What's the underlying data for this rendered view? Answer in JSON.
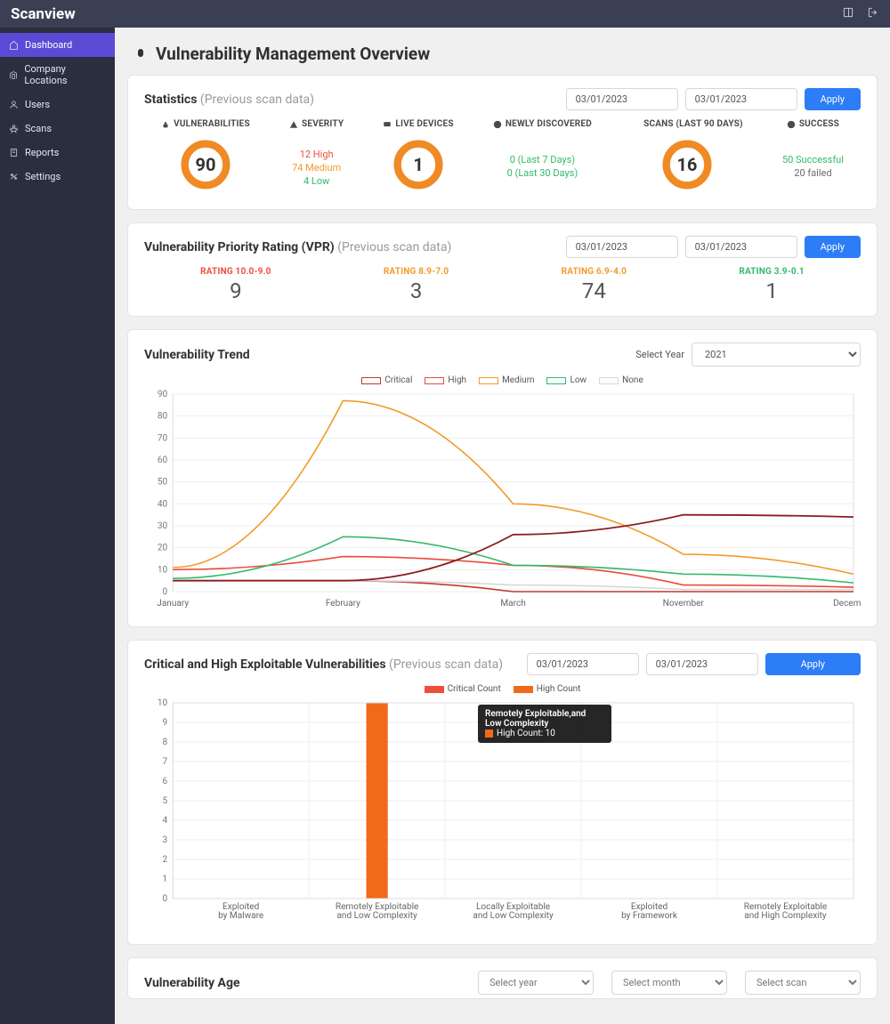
{
  "brand": "Scanview",
  "nav": [
    {
      "label": "Dashboard",
      "active": true
    },
    {
      "label": "Company Locations"
    },
    {
      "label": "Users"
    },
    {
      "label": "Scans"
    },
    {
      "label": "Reports"
    },
    {
      "label": "Settings"
    }
  ],
  "page_title": "Vulnerability Management Overview",
  "statistics": {
    "title": "Statistics",
    "subtitle": "(Previous scan data)",
    "date_from": "03/01/2023",
    "date_to": "03/01/2023",
    "apply": "Apply",
    "cols": {
      "vulns": {
        "label": "VULNERABILITIES",
        "value": "90"
      },
      "severity": {
        "label": "SEVERITY",
        "high": "12 High",
        "medium": "74 Medium",
        "low": "4 Low"
      },
      "live": {
        "label": "LIVE DEVICES",
        "value": "1"
      },
      "new": {
        "label": "NEWLY DISCOVERED",
        "l7": "0 (Last 7 Days)",
        "l30": "0 (Last 30 Days)"
      },
      "scans": {
        "label": "SCANS (LAST 90 DAYS)",
        "value": "16"
      },
      "success": {
        "label": "SUCCESS",
        "ok": "50 Successful",
        "fail": "20 failed"
      }
    }
  },
  "vpr": {
    "title": "Vulnerability Priority Rating (VPR)",
    "subtitle": "(Previous scan data)",
    "date_from": "03/01/2023",
    "date_to": "03/01/2023",
    "apply": "Apply",
    "buckets": [
      {
        "label": "RATING 10.0-9.0",
        "value": "9",
        "color": "#ef4e3b"
      },
      {
        "label": "RATING 8.9-7.0",
        "value": "3",
        "color": "#f39a2b"
      },
      {
        "label": "RATING 6.9-4.0",
        "value": "74",
        "color": "#f39a2b"
      },
      {
        "label": "RATING 3.9-0.1",
        "value": "1",
        "color": "#34b96d"
      }
    ]
  },
  "trend": {
    "title": "Vulnerability Trend",
    "select_label": "Select Year",
    "year": "2021",
    "legend": [
      "Critical",
      "High",
      "Medium",
      "Low",
      "None"
    ],
    "x_labels": [
      "January",
      "February",
      "March",
      "November",
      "December"
    ]
  },
  "exploit": {
    "title": "Critical and High Exploitable Vulnerabilities",
    "subtitle": "(Previous scan data)",
    "date_from": "03/01/2023",
    "date_to": "03/01/2023",
    "apply": "Apply",
    "legend": [
      "Critical Count",
      "High Count"
    ],
    "tooltip_title": "Remotely Exploitable,and Low Complexity",
    "tooltip_series": "High Count:",
    "tooltip_value": "10",
    "x_labels": [
      "Exploited\nby Malware",
      "Remotely Exploitable\nand Low Complexity",
      "Locally Exploitable\nand Low Complexity",
      "Exploited\nby Framework",
      "Remotely Exploitable\nand High Complexity"
    ]
  },
  "vuln_age": {
    "title": "Vulnerability Age",
    "sel_year": "Select year",
    "sel_month": "Select month",
    "sel_scan": "Select scan"
  },
  "chart_data": [
    {
      "id": "trend",
      "type": "line",
      "xlabel": "",
      "ylabel": "",
      "ylim": [
        0,
        90
      ],
      "y_ticks": [
        0,
        10,
        20,
        30,
        40,
        50,
        60,
        70,
        80,
        90
      ],
      "categories": [
        "January",
        "February",
        "March",
        "November",
        "December"
      ],
      "series": [
        {
          "name": "Critical",
          "color": "#c0392b",
          "values": [
            5,
            5,
            0,
            0,
            0
          ]
        },
        {
          "name": "High",
          "color": "#e94b3c",
          "values": [
            10,
            16,
            12,
            3,
            2
          ]
        },
        {
          "name": "Medium",
          "color": "#f39a2b",
          "values": [
            11,
            87,
            40,
            17,
            8
          ]
        },
        {
          "name": "Low",
          "color": "#34b96d",
          "values": [
            6,
            25,
            12,
            8,
            4
          ]
        },
        {
          "name": "None",
          "color": "#d8d8d8",
          "values": [
            5,
            5,
            3,
            1,
            1
          ]
        }
      ],
      "overlay_series": {
        "name": "Dark red overlay",
        "color": "#8a1d1d",
        "values": [
          5,
          5,
          26,
          35,
          34
        ]
      }
    },
    {
      "id": "exploit",
      "type": "bar",
      "ylim": [
        0,
        10
      ],
      "y_ticks": [
        0,
        1,
        2,
        3,
        4,
        5,
        6,
        7,
        8,
        9,
        10
      ],
      "categories": [
        "Exploited by Malware",
        "Remotely Exploitable and Low Complexity",
        "Locally Exploitable and Low Complexity",
        "Exploited by Framework",
        "Remotely Exploitable and High Complexity"
      ],
      "series": [
        {
          "name": "Critical Count",
          "color": "#ef4e3b",
          "values": [
            0,
            0,
            0,
            0,
            0
          ]
        },
        {
          "name": "High Count",
          "color": "#f06a1a",
          "values": [
            0,
            10,
            0,
            0,
            0
          ]
        }
      ]
    }
  ]
}
